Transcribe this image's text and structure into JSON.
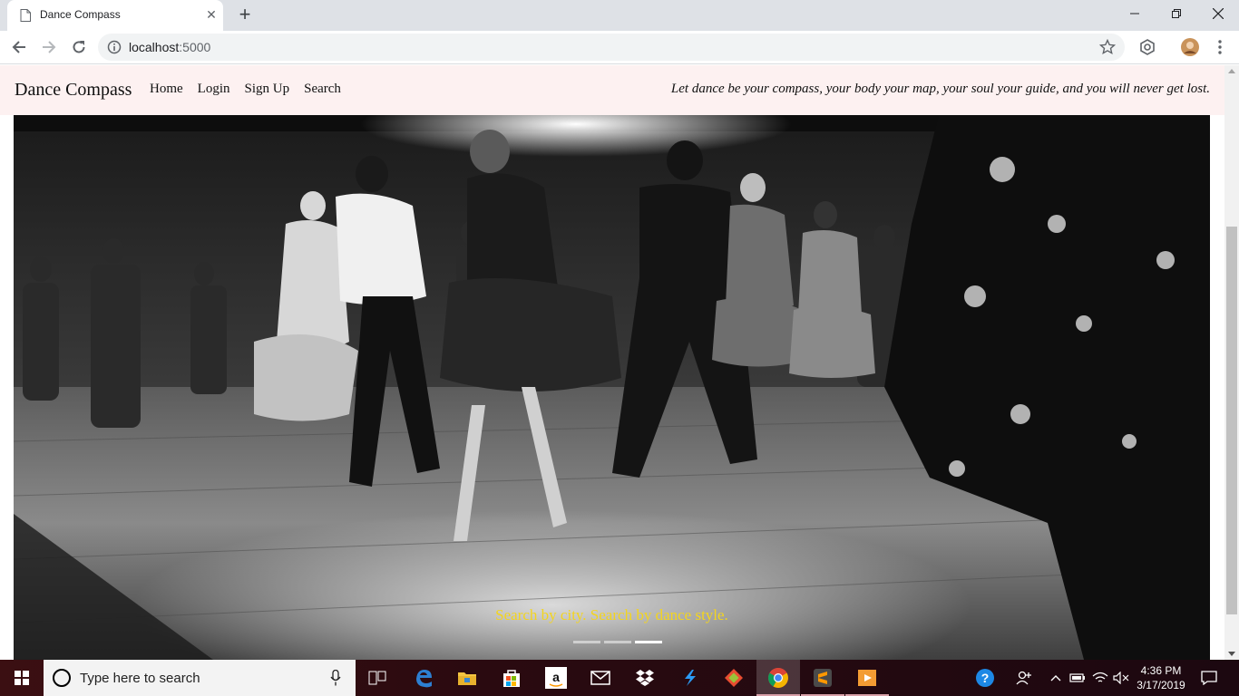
{
  "browser": {
    "tab_title": "Dance Compass",
    "url_host": "localhost",
    "url_port": ":5000"
  },
  "site": {
    "brand": "Dance Compass",
    "nav": [
      "Home",
      "Login",
      "Sign Up",
      "Search"
    ],
    "tagline": "Let dance be your compass, your body your map, your soul your guide, and you will never get lost."
  },
  "hero": {
    "caption": "Search by city. Search by dance style.",
    "slides": 3,
    "active_slide": 3
  },
  "taskbar": {
    "search_placeholder": "Type here to search",
    "time": "4:36 PM",
    "date": "3/17/2019",
    "apps": [
      "task-view",
      "edge",
      "file-explorer",
      "store",
      "amazon",
      "mail",
      "dropbox",
      "visual-studio",
      "git",
      "chrome",
      "sublime-text",
      "media-player"
    ]
  },
  "colors": {
    "navbar_bg": "#fdf1f1",
    "caption": "#f4d51d"
  }
}
